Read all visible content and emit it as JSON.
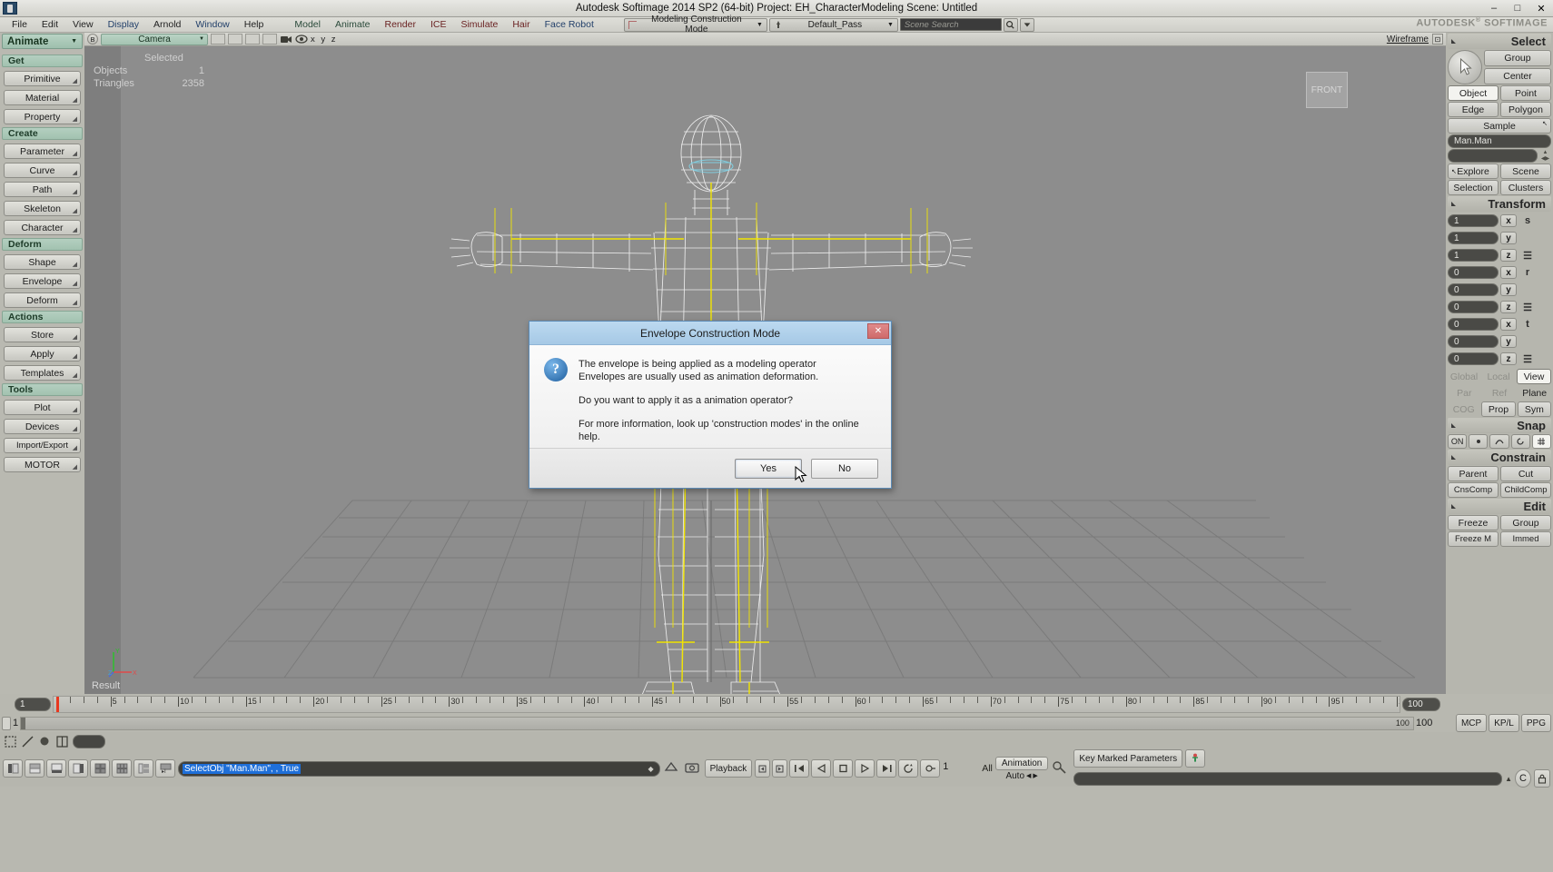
{
  "window": {
    "title": "Autodesk Softimage 2014 SP2 (64-bit)     Project: EH_CharacterModeling     Scene: Untitled",
    "minimize": "–",
    "maximize": "□",
    "close": "✕",
    "brand": "AUTODESK",
    "brand_sup": "®",
    "brand2": "SOFTIMAGE"
  },
  "menubar": {
    "items": [
      {
        "label": "File",
        "style": "dark"
      },
      {
        "label": "Edit",
        "style": "dark"
      },
      {
        "label": "View",
        "style": "dark"
      },
      {
        "label": "Display",
        "style": "blue"
      },
      {
        "label": "Arnold",
        "style": "dark"
      },
      {
        "label": "Window",
        "style": "blue"
      },
      {
        "label": "Help",
        "style": "dark"
      },
      {
        "label": "Model",
        "style": "green"
      },
      {
        "label": "Animate",
        "style": "green"
      },
      {
        "label": "Render",
        "style": "red"
      },
      {
        "label": "ICE",
        "style": "red"
      },
      {
        "label": "Simulate",
        "style": "red"
      },
      {
        "label": "Hair",
        "style": "red"
      },
      {
        "label": "Face Robot",
        "style": "blue"
      }
    ]
  },
  "toolbar": {
    "construction_mode": "Modeling Construction Mode",
    "pass": "Default_Pass",
    "search_placeholder": "Scene Search",
    "search_value": "",
    "arrow": "▼"
  },
  "left_panel": {
    "mode": "Animate",
    "mode_arrow": "▼",
    "groups": [
      {
        "title": "Get",
        "buttons": [
          "Primitive",
          "Material",
          "Property"
        ]
      },
      {
        "title": "Create",
        "buttons": [
          "Parameter",
          "Curve",
          "Path",
          "Skeleton",
          "Character"
        ]
      },
      {
        "title": "Deform",
        "buttons": [
          "Shape",
          "Envelope",
          "Deform"
        ]
      },
      {
        "title": "Actions",
        "buttons": [
          "Store",
          "Apply",
          "Templates"
        ]
      },
      {
        "title": "Tools",
        "buttons": [
          "Plot",
          "Devices",
          "Import/Export",
          "MOTOR"
        ]
      }
    ]
  },
  "viewport": {
    "camera_label": "Camera",
    "view_mode": "Wireframe",
    "view_cube": "FRONT",
    "axis_letters": "x y z",
    "result_label": "Result",
    "hud": {
      "header": "Selected",
      "rows": [
        {
          "key": "Objects",
          "value": "1"
        },
        {
          "key": "Triangles",
          "value": "2358"
        }
      ]
    },
    "axis_gizmo": {
      "y": "Y",
      "x": "X",
      "z": "Z"
    }
  },
  "right_panel": {
    "select": {
      "title": "Select",
      "buttons": [
        "Group",
        "Center",
        "Object",
        "Point",
        "Edge",
        "Polygon",
        "Sample"
      ],
      "active": "Object",
      "name_field": "Man.Man",
      "secondary_field": "",
      "explore": "Explore",
      "scene": "Scene",
      "selection": "Selection",
      "clusters": "Clusters"
    },
    "transform": {
      "title": "Transform",
      "scale": {
        "badge": "s",
        "x": "1",
        "y": "1",
        "z": "1"
      },
      "rotation": {
        "badge": "r",
        "x": "0",
        "y": "0",
        "z": "0"
      },
      "translation": {
        "badge": "t",
        "x": "0",
        "y": "0",
        "z": "0"
      },
      "axis_labels": {
        "x": "x",
        "y": "y",
        "z": "z"
      },
      "modes": [
        "Global",
        "Local",
        "View"
      ],
      "modes_active": "View",
      "refs": [
        "Par",
        "Ref",
        "Plane"
      ],
      "refs_active": "Plane",
      "extras": [
        "COG",
        "Prop",
        "Sym"
      ]
    },
    "snap": {
      "title": "Snap",
      "on_label": "ON",
      "icons": [
        "point-snap-icon",
        "curve-snap-icon",
        "rotate-snap-icon",
        "grid-snap-icon"
      ],
      "active": "grid-snap-icon"
    },
    "constrain": {
      "title": "Constrain",
      "buttons": [
        "Parent",
        "Cut",
        "CnsComp",
        "ChildComp"
      ]
    },
    "edit": {
      "title": "Edit",
      "buttons": [
        "Freeze",
        "Group",
        "Freeze M",
        "Immed"
      ]
    }
  },
  "dialog": {
    "title": "Envelope Construction Mode",
    "close": "✕",
    "icon": "question-icon",
    "lines": [
      "The envelope is being applied as a modeling operator",
      "Envelopes are usually used as animation deformation.",
      "Do you want to apply it as a animation operator?",
      "For more information, look up 'construction modes' in the online help."
    ],
    "yes": "Yes",
    "no": "No"
  },
  "timeline": {
    "start_frame": "1",
    "current_frame": "1",
    "end_frame": "100",
    "end_frame2": "100",
    "range_end": "100",
    "tick_labels": [
      "5",
      "10",
      "15",
      "20",
      "25",
      "30",
      "35",
      "40",
      "45",
      "50",
      "55",
      "60",
      "65",
      "70",
      "75",
      "80",
      "85",
      "90",
      "95"
    ],
    "tick_values": [
      5,
      10,
      15,
      20,
      25,
      30,
      35,
      40,
      45,
      50,
      55,
      60,
      65,
      70,
      75,
      80,
      85,
      90,
      95
    ],
    "axis_min": 1,
    "axis_max": 100
  },
  "bottom": {
    "command": "SelectObj \"Man.Man\", , True",
    "playback_label": "Playback",
    "transport": [
      "step-back-small-icon",
      "step-fwd-small-icon",
      "jump-start-icon",
      "play-reverse-icon",
      "stop-icon",
      "play-icon",
      "jump-end-icon",
      "loop-icon",
      "key-icon"
    ],
    "frame_value": "1",
    "all_label": "All",
    "animation_label": "Animation",
    "auto_label": "Auto",
    "key_marked": "Key Marked Parameters",
    "mcp": "MCP",
    "kpl": "KP/L",
    "ppg": "PPG"
  }
}
